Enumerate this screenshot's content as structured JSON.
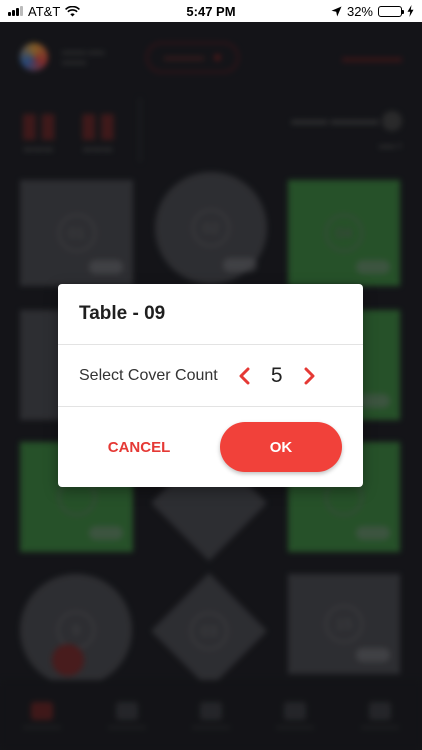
{
  "status_bar": {
    "carrier": "AT&T",
    "time": "5:47 PM",
    "battery_percent": "32%",
    "battery_level": 0.32
  },
  "dialog": {
    "title": "Table - 09",
    "label": "Select Cover Count",
    "count": "5",
    "cancel_label": "CANCEL",
    "ok_label": "OK",
    "accent_color": "#f1413a",
    "chevron_color": "#e53935"
  },
  "background_tables": [
    "01",
    "02",
    "04",
    "9",
    "03",
    "15"
  ]
}
